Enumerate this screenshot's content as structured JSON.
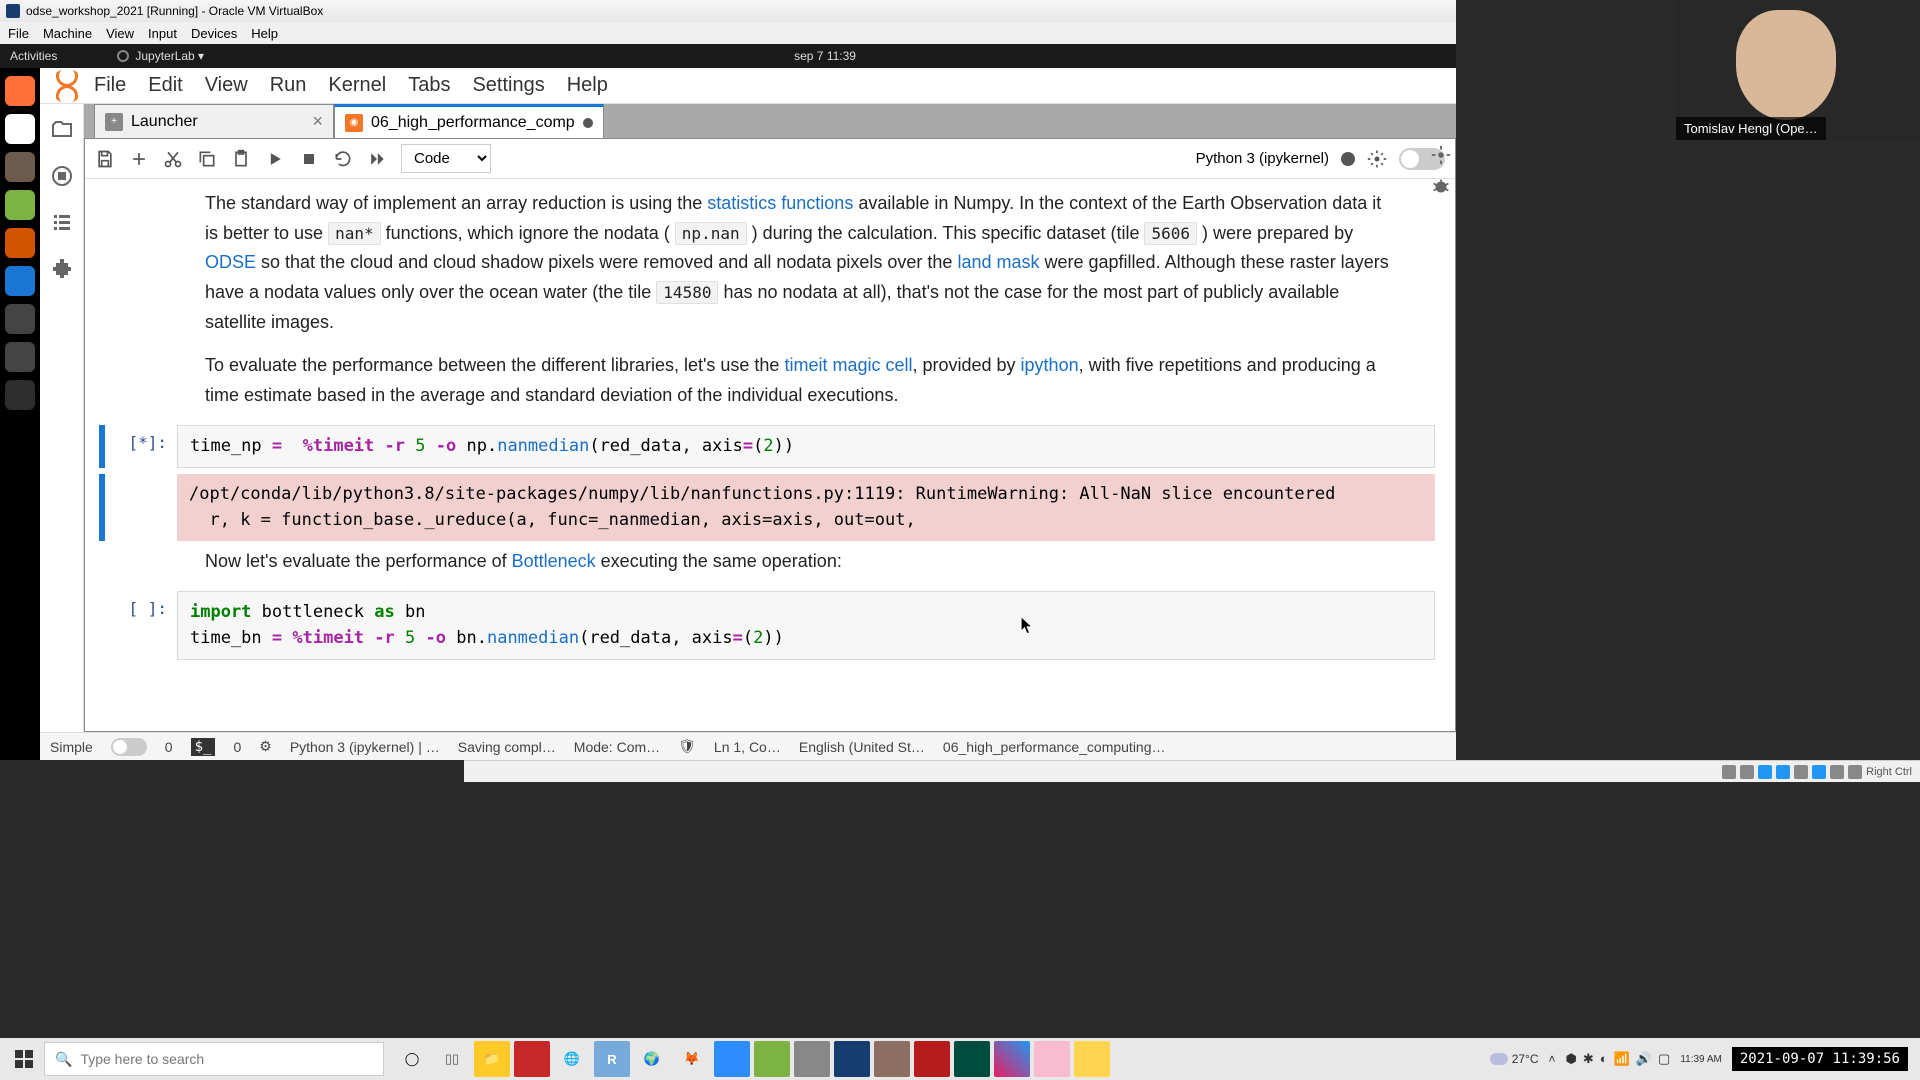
{
  "vbox": {
    "title": "odse_workshop_2021 [Running] - Oracle VM VirtualBox",
    "menu": [
      "File",
      "Machine",
      "View",
      "Input",
      "Devices",
      "Help"
    ],
    "status_right": "Right Ctrl"
  },
  "ubuntu": {
    "activities": "Activities",
    "app": "JupyterLab ▾",
    "clock": "sep 7  11:39"
  },
  "browser": {
    "title": "JupyterLab"
  },
  "jupyter": {
    "menu": [
      "File",
      "Edit",
      "View",
      "Run",
      "Kernel",
      "Tabs",
      "Settings",
      "Help"
    ],
    "tabs": {
      "launcher": "Launcher",
      "notebook": "06_high_performance_comp"
    },
    "toolbar": {
      "celltype": "Code",
      "kernel": "Python 3 (ipykernel)"
    },
    "status": {
      "simple": "Simple",
      "zero1": "0",
      "zero2": "0",
      "kernel": "Python 3 (ipykernel) | …",
      "save": "Saving compl…",
      "mode": "Mode: Com…",
      "ln": "Ln 1, Co…",
      "lang": "English (United St…",
      "file": "06_high_performance_computing…"
    }
  },
  "md": {
    "p1a": "The standard way of implement an array reduction is using the ",
    "p1link1": "statistics functions",
    "p1b": " available in Numpy. In the context of the Earth Observation data it is better to use ",
    "p1code1": "nan*",
    "p1c": " functions, which ignore the nodata ( ",
    "p1code2": "np.nan",
    "p1d": " ) during the calculation. This specific dataset (tile ",
    "p1code3": "5606",
    "p1e": " ) were prepared by ",
    "p1link2": "ODSE",
    "p1f": " so that the cloud and cloud shadow pixels were removed and all nodata pixels over the ",
    "p1link3": "land mask",
    "p1g": " were gapfilled. Although these raster layers have a nodata values only over the ocean water (the tile ",
    "p1code4": "14580",
    "p1h": " has no nodata at all), that's not the case for the most part of publicly available satellite images.",
    "p2a": "To evaluate the performance between the different libraries, let's use the ",
    "p2link1": "timeit magic cell",
    "p2b": ", provided by ",
    "p2link2": "ipython",
    "p2c": ", with five repetitions and producing a time estimate based in the average and standard deviation of the individual executions.",
    "p3a": "Now let's evaluate the performance of ",
    "p3link1": "Bottleneck",
    "p3b": " executing the same operation:"
  },
  "cells": {
    "prompt1": "[*]:",
    "prompt2": "[ ]:",
    "warning": "/opt/conda/lib/python3.8/site-packages/numpy/lib/nanfunctions.py:1119: RuntimeWarning: All-NaN slice encountered\n  r, k = function_base._ureduce(a, func=_nanmedian, axis=axis, out=out,"
  },
  "webcam": {
    "name": "Tomislav Hengl (Ope…"
  },
  "windows": {
    "search": "Type here to search",
    "temp": "27°C",
    "clock": "2021-09-07 11:39:56",
    "time_small": "11:39 AM"
  }
}
